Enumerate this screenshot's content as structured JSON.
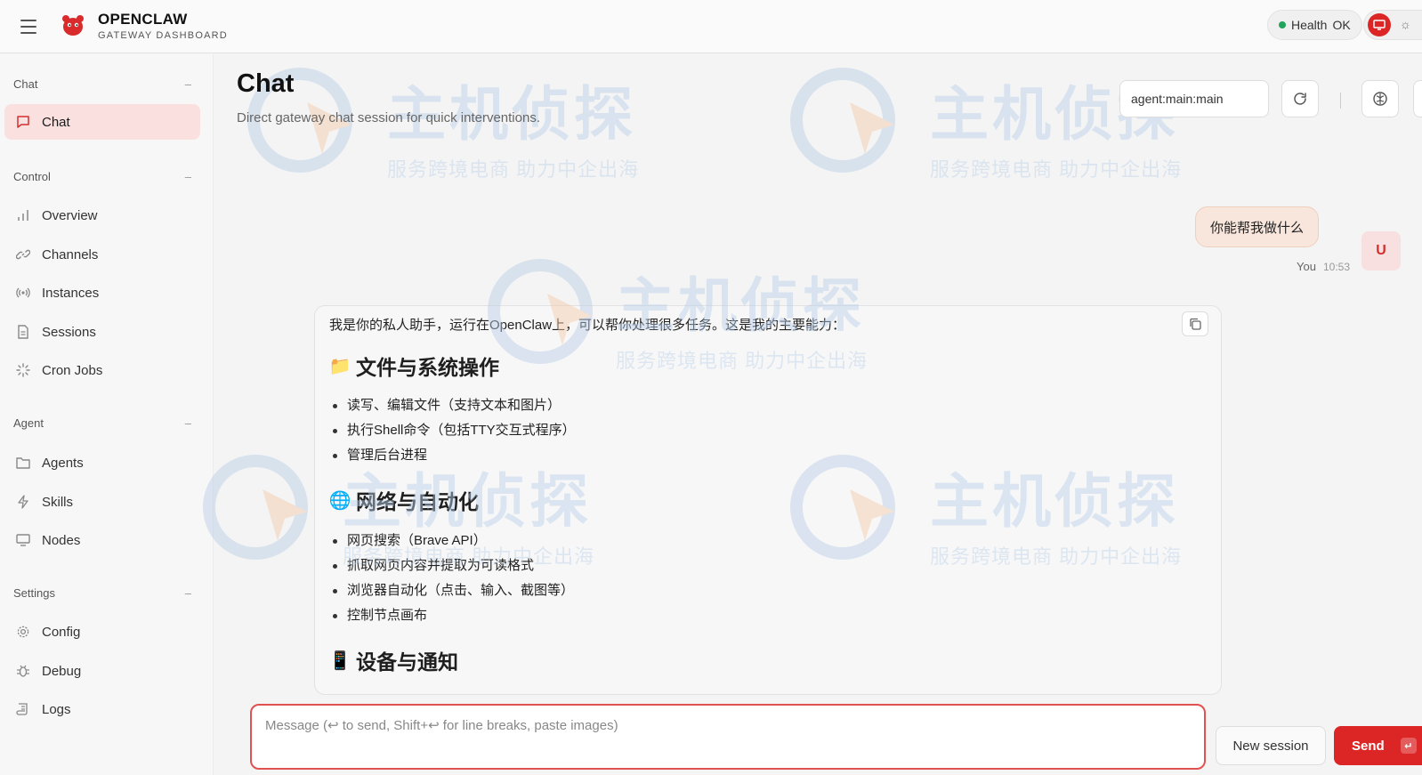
{
  "brand": {
    "name": "OPENCLAW",
    "subtitle": "GATEWAY DASHBOARD"
  },
  "header": {
    "health_label": "Health",
    "health_value": "OK"
  },
  "sidebar": {
    "groups": [
      {
        "title": "Chat",
        "items": [
          {
            "label": "Chat",
            "icon": "chat-bubble-icon",
            "active": true
          }
        ]
      },
      {
        "title": "Control",
        "items": [
          {
            "label": "Overview",
            "icon": "bar-chart-icon"
          },
          {
            "label": "Channels",
            "icon": "link-icon"
          },
          {
            "label": "Instances",
            "icon": "broadcast-icon"
          },
          {
            "label": "Sessions",
            "icon": "document-icon"
          },
          {
            "label": "Cron Jobs",
            "icon": "loader-icon"
          }
        ]
      },
      {
        "title": "Agent",
        "items": [
          {
            "label": "Agents",
            "icon": "folder-icon"
          },
          {
            "label": "Skills",
            "icon": "lightning-icon"
          },
          {
            "label": "Nodes",
            "icon": "monitor-icon"
          }
        ]
      },
      {
        "title": "Settings",
        "items": [
          {
            "label": "Config",
            "icon": "gear-icon"
          },
          {
            "label": "Debug",
            "icon": "bug-icon"
          },
          {
            "label": "Logs",
            "icon": "scroll-icon"
          }
        ]
      }
    ],
    "collapse_symbol": "–"
  },
  "main": {
    "title": "Chat",
    "subtitle": "Direct gateway chat session for quick interventions.",
    "session_key": "agent:main:main"
  },
  "messages": {
    "user": {
      "text": "你能帮我做什么",
      "author": "You",
      "time": "10:53",
      "avatar": "U"
    },
    "assistant": {
      "intro": "我是你的私人助手，运行在OpenClaw上，可以帮你处理很多任务。这是我的主要能力：",
      "sections": [
        {
          "emoji": "📁",
          "heading": "文件与系统操作",
          "items": [
            "读写、编辑文件（支持文本和图片）",
            "执行Shell命令（包括TTY交互式程序）",
            "管理后台进程"
          ]
        },
        {
          "emoji": "🌐",
          "heading": "网络与自动化",
          "items": [
            "网页搜索（Brave API）",
            "抓取网页内容并提取为可读格式",
            "浏览器自动化（点击、输入、截图等）",
            "控制节点画布"
          ]
        },
        {
          "emoji": "📱",
          "heading": "设备与通知",
          "items": []
        }
      ]
    }
  },
  "composer": {
    "placeholder": "Message (↩ to send, Shift+↩ for line breaks, paste images)",
    "new_session_label": "New session",
    "send_label": "Send",
    "send_kbd": "↵"
  },
  "watermark": {
    "main": "主机侦探",
    "sub": "服务跨境电商 助力中企出海"
  },
  "colors": {
    "accent": "#dc2626",
    "active_bg": "#fbe0e0",
    "health_dot": "#22a45a",
    "user_bubble": "#f8e6dc"
  }
}
